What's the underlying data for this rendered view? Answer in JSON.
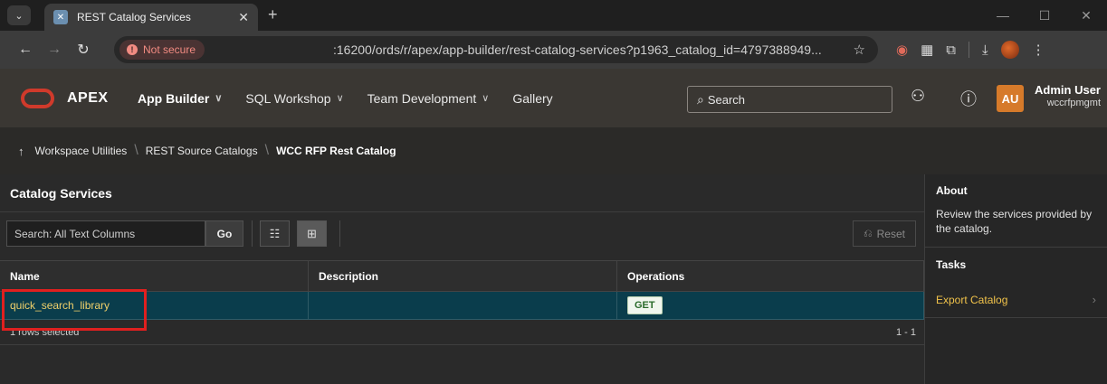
{
  "browser": {
    "tab_title": "REST Catalog Services",
    "security_label": "Not secure",
    "url": ":16200/ords/r/apex/app-builder/rest-catalog-services?p1963_catalog_id=4797388949..."
  },
  "apex": {
    "brand": "APEX",
    "nav": [
      {
        "label": "App Builder",
        "chevron": "∨"
      },
      {
        "label": "SQL Workshop",
        "chevron": "∨"
      },
      {
        "label": "Team Development",
        "chevron": "∨"
      },
      {
        "label": "Gallery"
      }
    ],
    "search_placeholder": "Search",
    "user": {
      "initials": "AU",
      "name": "Admin User",
      "workspace": "wccrfpmgmt"
    }
  },
  "breadcrumb": {
    "items": [
      "Workspace Utilities",
      "REST Source Catalogs"
    ],
    "current": "WCC RFP Rest Catalog"
  },
  "region": {
    "title": "Catalog Services",
    "search_placeholder": "Search: All Text Columns",
    "go_label": "Go",
    "reset_label": "Reset",
    "columns": [
      "Name",
      "Description",
      "Operations"
    ],
    "rows": [
      {
        "name": "quick_search_library",
        "description": "",
        "operation": "GET"
      }
    ],
    "footer_left": "1 rows selected",
    "footer_right": "1 - 1"
  },
  "sidebar": {
    "about_title": "About",
    "about_text": "Review the services provided by the catalog.",
    "tasks_title": "Tasks",
    "task_link": "Export Catalog"
  },
  "colors": {
    "selected_row": "#0a3d4c",
    "link": "#f0c24a",
    "highlight": "#e0201f",
    "oracle_red": "#d03a2b"
  }
}
